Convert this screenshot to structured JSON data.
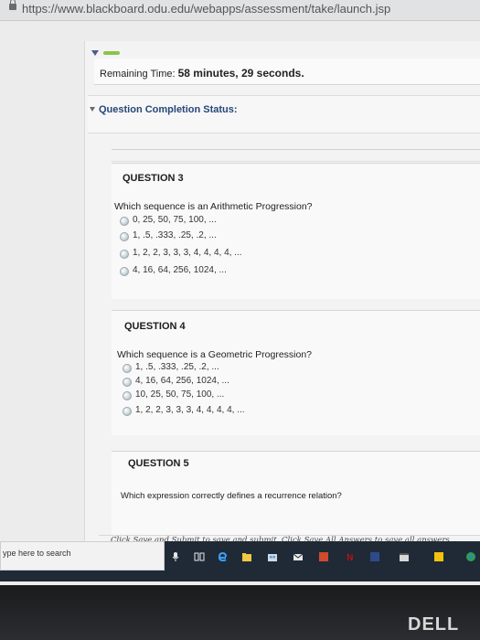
{
  "browser": {
    "url": "https://www.blackboard.odu.edu/webapps/assessment/take/launch.jsp"
  },
  "timer": {
    "label": "Remaining Time:",
    "value": "58 minutes, 29 seconds."
  },
  "status": {
    "label": "Question Completion Status:"
  },
  "questions": [
    {
      "title": "QUESTION 3",
      "text": "Which sequence is an Arithmetic Progression?",
      "options": [
        "0, 25, 50, 75, 100, ...",
        "1, .5, .333, .25, .2, ...",
        "1, 2, 2, 3, 3, 3, 4, 4, 4, 4, ...",
        "4, 16, 64, 256, 1024, ..."
      ]
    },
    {
      "title": "QUESTION 4",
      "text": "Which sequence is a Geometric Progression?",
      "options": [
        "1, .5, .333, .25, .2, ...",
        "4, 16, 64, 256, 1024, ...",
        "10, 25, 50, 75, 100, ...",
        "1, 2, 2, 3, 3, 3, 4, 4, 4, 4, ..."
      ]
    },
    {
      "title": "QUESTION 5",
      "text": "Which expression correctly defines a recurrence relation?",
      "options": []
    }
  ],
  "footer": {
    "hint": "Click Save and Submit to save and submit. Click Save All Answers to save all answers."
  },
  "taskbar": {
    "search_placeholder": "ype here to search"
  },
  "brand": {
    "logo_text": "DELL"
  }
}
